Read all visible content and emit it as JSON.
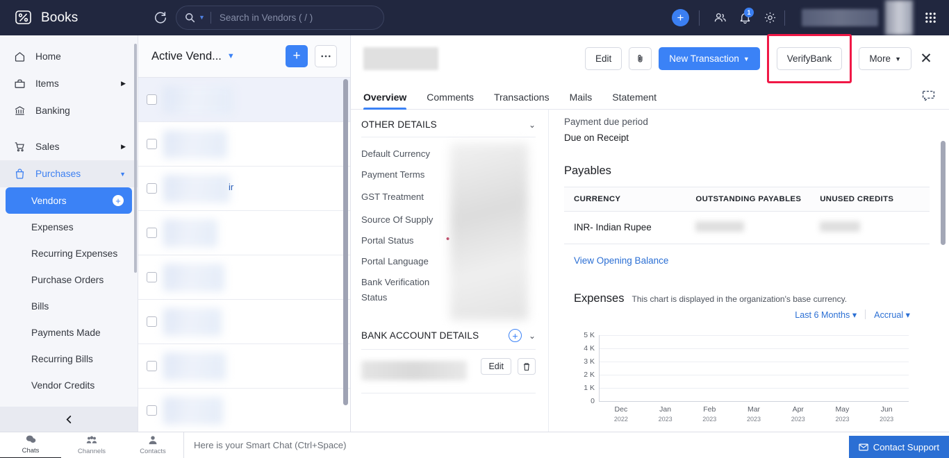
{
  "header": {
    "brand": "Books",
    "logo_icon": "books-logo-icon",
    "refresh_icon": "refresh-icon",
    "search": {
      "icon": "search-icon",
      "dropdown_icon": "chevron-down-icon",
      "placeholder": "Search in Vendors ( / )",
      "value": ""
    },
    "add_icon": "plus-icon",
    "people_icon": "people-icon",
    "notifications_icon": "bell-icon",
    "notifications_count": "1",
    "settings_icon": "gear-icon",
    "org_name_redacted": "",
    "avatar": "user-avatar",
    "apps_icon": "grid-apps-icon"
  },
  "sidebar": {
    "items": [
      {
        "label": "Home",
        "icon": "home-icon",
        "expandable": false
      },
      {
        "label": "Items",
        "icon": "box-icon",
        "expandable": true
      },
      {
        "label": "Banking",
        "icon": "bank-icon",
        "expandable": false
      },
      {
        "label": "Sales",
        "icon": "cart-icon",
        "expandable": true
      },
      {
        "label": "Purchases",
        "icon": "bag-icon",
        "expandable": true,
        "active": true
      }
    ],
    "sub_items": [
      {
        "label": "Vendors",
        "selected": true,
        "has_add": true
      },
      {
        "label": "Expenses",
        "selected": false
      },
      {
        "label": "Recurring Expenses",
        "selected": false
      },
      {
        "label": "Purchase Orders",
        "selected": false
      },
      {
        "label": "Bills",
        "selected": false
      },
      {
        "label": "Payments Made",
        "selected": false
      },
      {
        "label": "Recurring Bills",
        "selected": false
      },
      {
        "label": "Vendor Credits",
        "selected": false
      }
    ],
    "collapse_icon": "chevron-left-icon"
  },
  "list_panel": {
    "title": "Active Vend...",
    "title_chevron": "chevron-down-icon",
    "add_button_icon": "plus-icon",
    "more_button_icon": "ellipsis-icon",
    "rows": [
      {
        "selected": true,
        "redacted": true,
        "blur_width": 100
      },
      {
        "selected": false,
        "redacted": true,
        "blur_width": 92
      },
      {
        "selected": false,
        "redacted": true,
        "blur_width": 96,
        "extra_text": "ir"
      },
      {
        "selected": false,
        "redacted": true,
        "blur_width": 78
      },
      {
        "selected": false,
        "redacted": true,
        "blur_width": 88
      },
      {
        "selected": false,
        "redacted": true,
        "blur_width": 84
      },
      {
        "selected": false,
        "redacted": true,
        "blur_width": 90
      },
      {
        "selected": false,
        "redacted": true,
        "blur_width": 86
      }
    ]
  },
  "detail": {
    "vendor_name_redacted": "",
    "actions": {
      "edit": "Edit",
      "attachment_icon": "paperclip-icon",
      "new_transaction": "New Transaction",
      "verify_bank": "VerifyBank",
      "more": "More",
      "close_icon": "close-icon"
    },
    "highlight_color": "#f01846",
    "tabs": [
      {
        "label": "Overview",
        "active": true
      },
      {
        "label": "Comments",
        "active": false
      },
      {
        "label": "Transactions",
        "active": false
      },
      {
        "label": "Mails",
        "active": false
      },
      {
        "label": "Statement",
        "active": false
      }
    ],
    "tab_chat_icon": "comment-bubble-icon",
    "other_details": {
      "section_title": "OTHER DETAILS",
      "collapse_icon": "chevron-down-icon",
      "fields": [
        {
          "label": "Default Currency",
          "value_redacted": true
        },
        {
          "label": "Payment Terms",
          "value_redacted": true
        },
        {
          "label": "GST Treatment",
          "value_redacted": true
        },
        {
          "label": "Source Of Supply",
          "value_redacted": true
        },
        {
          "label": "Portal Status",
          "value_redacted": true,
          "dot": true
        },
        {
          "label": "Portal Language",
          "value_redacted": true
        },
        {
          "label": "Bank Verification Status",
          "value_redacted": true
        }
      ]
    },
    "bank_account_details": {
      "section_title": "BANK ACCOUNT DETAILS",
      "add_icon": "plus-circle-icon",
      "collapse_icon": "chevron-down-icon",
      "row_redacted": true,
      "edit_label": "Edit",
      "delete_icon": "trash-icon"
    },
    "payment_due": {
      "label": "Payment due period",
      "value": "Due on Receipt"
    },
    "payables": {
      "title": "Payables",
      "columns": [
        "CURRENCY",
        "OUTSTANDING PAYABLES",
        "UNUSED CREDITS"
      ],
      "rows": [
        {
          "currency": "INR- Indian Rupee",
          "outstanding_redacted": true,
          "unused_redacted": true
        }
      ],
      "link": "View Opening Balance"
    }
  },
  "chart_data": {
    "type": "bar",
    "title": "Expenses",
    "subtitle": "This chart is displayed in the organization's base currency.",
    "range_selector": "Last 6 Months",
    "basis_selector": "Accrual",
    "categories": [
      "Dec",
      "Jan",
      "Feb",
      "Mar",
      "Apr",
      "May",
      "Jun"
    ],
    "category_years": [
      "2022",
      "2023",
      "2023",
      "2023",
      "2023",
      "2023",
      "2023"
    ],
    "values": [
      0,
      0,
      0,
      0,
      0,
      0,
      0
    ],
    "yticks": [
      "5 K",
      "4 K",
      "3 K",
      "2 K",
      "1 K",
      "0"
    ],
    "ylim": [
      0,
      5000
    ],
    "xlabel": "",
    "ylabel": "",
    "grid": true,
    "legend": "none"
  },
  "bottom_bar": {
    "tabs": [
      {
        "label": "Chats",
        "icon": "chat-bubbles-icon",
        "active": true
      },
      {
        "label": "Channels",
        "icon": "channels-icon",
        "active": false
      },
      {
        "label": "Contacts",
        "icon": "contact-icon",
        "active": false
      }
    ],
    "smart_chat_placeholder": "Here is your Smart Chat (Ctrl+Space)",
    "support_button": "Contact Support",
    "support_icon": "envelope-icon"
  }
}
